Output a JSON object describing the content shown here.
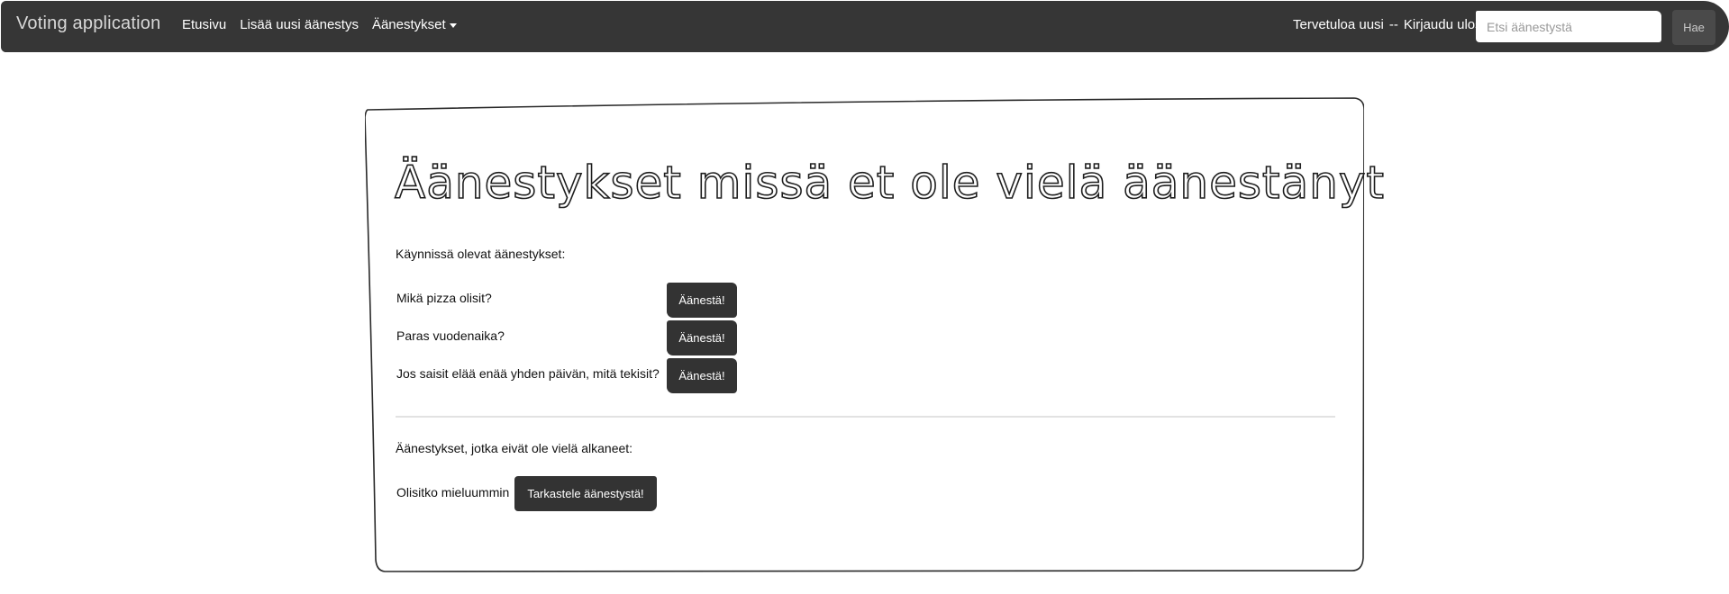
{
  "navbar": {
    "brand": "Voting application",
    "links": {
      "home": "Etusivu",
      "add_poll": "Lisää uusi äänestys",
      "polls_dropdown": "Äänestykset"
    },
    "user": {
      "welcome": "Tervetuloa uusi",
      "separator": "--",
      "logout": "Kirjaudu ulos"
    },
    "search": {
      "placeholder": "Etsi äänestystä",
      "button_label": "Hae"
    }
  },
  "main": {
    "title": "Äänestykset missä et ole vielä äänestänyt",
    "ongoing_heading": "Käynnissä olevat äänestykset:",
    "ongoing_polls": [
      {
        "question": "Mikä pizza olisit?",
        "button": "Äänestä!"
      },
      {
        "question": "Paras vuodenaika?",
        "button": "Äänestä!"
      },
      {
        "question": "Jos saisit elää enää yhden päivän, mitä tekisit?",
        "button": "Äänestä!"
      }
    ],
    "upcoming_heading": "Äänestykset, jotka eivät ole vielä alkaneet:",
    "upcoming_polls": [
      {
        "question": "Olisitko mieluummin",
        "button": "Tarkastele äänestystä!"
      }
    ]
  },
  "colors": {
    "navbar_bg": "#363636",
    "button_bg": "#333333",
    "search_button_bg": "#4a4a4a"
  }
}
